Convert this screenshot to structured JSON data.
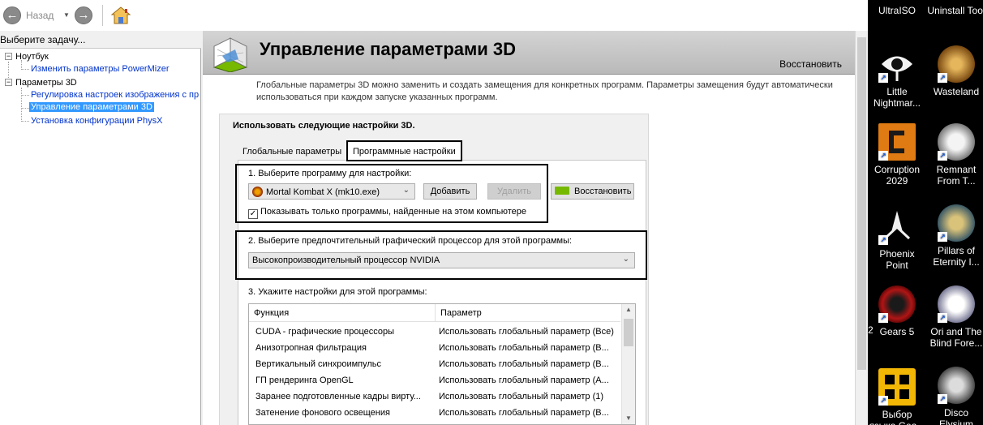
{
  "toolbar": {
    "back_label": "Назад"
  },
  "left_panel": {
    "header": "Выберите задачу...",
    "tree": [
      {
        "label": "Ноутбук",
        "children": [
          "Изменить параметры PowerMizer"
        ]
      },
      {
        "label": "Параметры 3D",
        "children": [
          "Регулировка настроек изображения с пр",
          "Управление параметрами 3D",
          "Установка конфигурации PhysX"
        ]
      }
    ],
    "selected_item": "Управление параметрами 3D"
  },
  "main": {
    "title": "Управление параметрами 3D",
    "restore_label": "Восстановить",
    "description": "Глобальные параметры 3D можно заменить и создать замещения для конкретных программ. Параметры замещения будут автоматически использоваться при каждом запуске указанных программ.",
    "settings_heading": "Использовать следующие настройки 3D.",
    "tabs": [
      {
        "label": "Глобальные параметры",
        "active": false
      },
      {
        "label": "Программные настройки",
        "active": true
      }
    ],
    "step1": {
      "label": "1. Выберите программу для настройки:",
      "program_value": "Mortal Kombat X (mk10.exe)",
      "add_label": "Добавить",
      "remove_label": "Удалить",
      "restore_label": "Восстановить",
      "checkbox_label": "Показывать только программы, найденные на этом компьютере",
      "checkbox_checked": true
    },
    "step2": {
      "label": "2. Выберите предпочтительный графический процессор для этой программы:",
      "gpu_value": "Высокопроизводительный процессор NVIDIA"
    },
    "step3": {
      "label": "3. Укажите настройки для этой программы:",
      "columns": [
        "Функция",
        "Параметр"
      ],
      "rows": [
        {
          "function": "CUDA - графические процессоры",
          "param": "Использовать глобальный параметр (Все)"
        },
        {
          "function": "Анизотропная фильтрация",
          "param": "Использовать глобальный параметр (В..."
        },
        {
          "function": "Вертикальный синхроимпульс",
          "param": "Использовать глобальный параметр (В..."
        },
        {
          "function": "ГП рендеринга OpenGL",
          "param": "Использовать глобальный параметр (А..."
        },
        {
          "function": "Заранее подготовленные кадры вирту...",
          "param": "Использовать глобальный параметр (1)"
        },
        {
          "function": "Затенение фонового освещения",
          "param": "Использовать глобальный параметр (В..."
        }
      ]
    }
  },
  "desktop": {
    "items": [
      {
        "label": "UltraISO",
        "icon": "ultraiso-icon"
      },
      {
        "label": "Uninstall Tool",
        "icon": "uninstall-tool-icon"
      },
      {
        "label": "Little Nightmar...",
        "icon": "little-nightmares-icon"
      },
      {
        "label": "Wasteland",
        "icon": "wasteland-icon"
      },
      {
        "label": "Corruption 2029",
        "icon": "corruption-2029-icon"
      },
      {
        "label": "Remnant From T...",
        "icon": "remnant-icon"
      },
      {
        "label": "Phoenix Point",
        "icon": "phoenix-point-icon"
      },
      {
        "label": "Pillars of Eternity I...",
        "icon": "pillars-of-eternity-icon"
      },
      {
        "label": "Gears 5",
        "icon": "gears-5-icon"
      },
      {
        "label": "Ori and The Blind Fore...",
        "icon": "ori-icon"
      },
      {
        "label": "Выбор языка Gea...",
        "icon": "language-select-icon"
      },
      {
        "label": "Disco Elysium",
        "icon": "disco-elysium-icon"
      }
    ],
    "stray_digit": "2"
  }
}
